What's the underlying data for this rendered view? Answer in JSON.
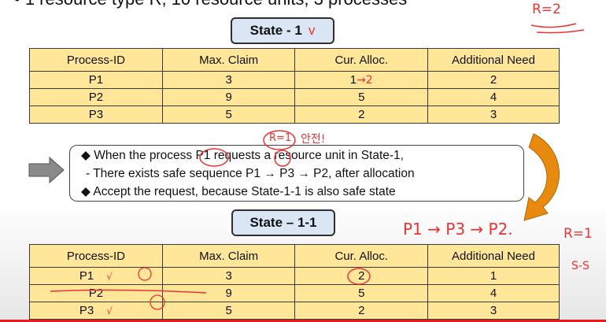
{
  "header": {
    "line": "• 1 resource type R, 10 resource units, 3 processes"
  },
  "state1": {
    "title": "State - 1"
  },
  "state11": {
    "title": "State – 1-1"
  },
  "table_headers": [
    "Process-ID",
    "Max. Claim",
    "Cur. Alloc.",
    "Additional Need"
  ],
  "table1": {
    "rows": [
      [
        "P1",
        "3",
        "1",
        "2"
      ],
      [
        "P2",
        "9",
        "5",
        "4"
      ],
      [
        "P3",
        "5",
        "2",
        "3"
      ]
    ]
  },
  "table2": {
    "rows": [
      [
        "P1",
        "3",
        "2",
        "1"
      ],
      [
        "P2",
        "9",
        "5",
        "4"
      ],
      [
        "P3",
        "5",
        "2",
        "3"
      ]
    ]
  },
  "note": {
    "line1": "When the process P1 requests a resource unit in State-1,",
    "line2": "- There exists safe sequence P1 → P3 → P2, after allocation",
    "line3": "Accept the request, because State-1-1 is also safe state"
  },
  "annotations": {
    "r_equals_2": "R=2",
    "r_equals_1": "R=1",
    "r_eq_1_circle": "R=1",
    "ok_korean": "안전!",
    "sequence": "P1 → P3 → P2.",
    "ss": "S-S",
    "one_to_two": "→2",
    "check1": "√",
    "check2": "√"
  },
  "colors": {
    "table_fill": "#ffe699",
    "state_fill": "#dbe6f4",
    "ink_red": "#e33333",
    "arrow_orange": "#e88a10"
  }
}
